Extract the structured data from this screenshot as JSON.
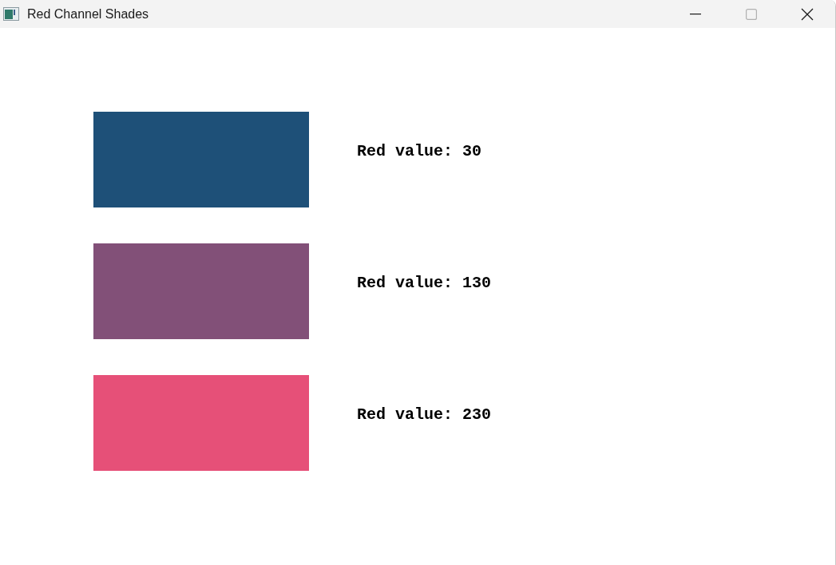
{
  "window": {
    "title": "Red Channel Shades"
  },
  "swatches": [
    {
      "color": "#1e5078",
      "label": "Red value: 30"
    },
    {
      "color": "#825078",
      "label": "Red value: 130"
    },
    {
      "color": "#e65078",
      "label": "Red value: 230"
    }
  ]
}
